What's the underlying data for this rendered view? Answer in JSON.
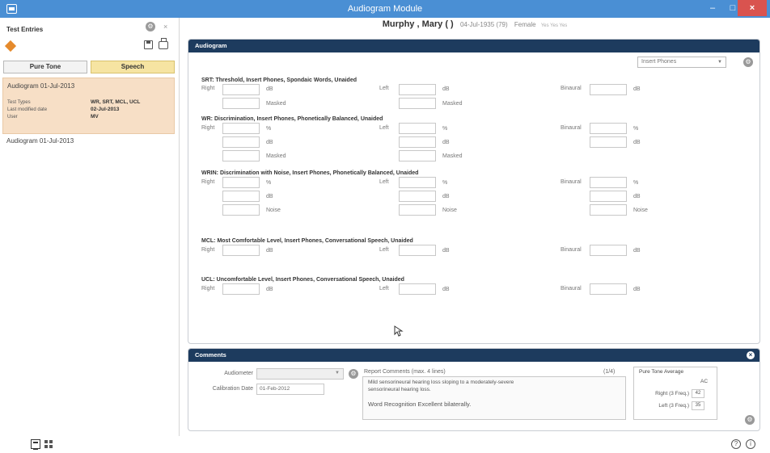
{
  "window": {
    "title": "Audiogram Module",
    "minimize": "–",
    "maximize": "□",
    "close": "×"
  },
  "sidebar": {
    "header": "Test Entries",
    "tabs": [
      {
        "label": "Pure Tone"
      },
      {
        "label": "Speech"
      }
    ],
    "entries": [
      {
        "title": "Audiogram   01-Jul-2013",
        "details": [
          {
            "key": "Test Types",
            "value": "WR, SRT, MCL, UCL"
          },
          {
            "key": "Last modified date",
            "value": "02-Jul-2013"
          },
          {
            "key": "User",
            "value": "MV"
          }
        ]
      },
      {
        "title": "Audiogram   01-Jul-2013"
      }
    ]
  },
  "patient": {
    "name": "Murphy , Mary ( )",
    "dob": "04-Jul-1935 (79)",
    "gender": "Female",
    "extra": "Yes Yes Yes"
  },
  "audiogram": {
    "header": "Audiogram",
    "transducer": "Insert Phones",
    "sections": {
      "srt": {
        "title": "SRT: Threshold, Insert Phones, Spondaic Words, Unaided",
        "right": "Right",
        "left": "Left",
        "binaural": "Binaural",
        "db": "dB",
        "masked": "Masked"
      },
      "wr": {
        "title": "WR: Discrimination, Insert Phones, Phonetically Balanced, Unaided",
        "right": "Right",
        "left": "Left",
        "binaural": "Binaural",
        "pct": "%",
        "db": "dB",
        "masked": "Masked"
      },
      "wrin": {
        "title": "WRIN: Discrimination with Noise, Insert Phones, Phonetically Balanced, Unaided",
        "right": "Right",
        "left": "Left",
        "binaural": "Binaural",
        "pct": "%",
        "db": "dB",
        "noise": "Noise"
      },
      "mcl": {
        "title": "MCL: Most Comfortable Level, Insert Phones, Conversational Speech, Unaided",
        "right": "Right",
        "left": "Left",
        "binaural": "Binaural",
        "db": "dB"
      },
      "ucl": {
        "title": "UCL: Uncomfortable Level, Insert Phones, Conversational Speech, Unaided",
        "right": "Right",
        "left": "Left",
        "binaural": "Binaural",
        "db": "dB"
      }
    }
  },
  "comments": {
    "header": "Comments",
    "audiometer_label": "Audiometer",
    "calibration_label": "Calibration Date",
    "calibration_value": "01-Feb-2012",
    "report_label": "Report Comments (max. 4 lines)",
    "report_count": "(1/4)",
    "report_lines": [
      "Mild sensorineural hearing loss sloping to a moderately-severe",
      "sensorineural hearing loss.",
      "",
      "Word Recognition Excellent bilaterally."
    ],
    "pta": {
      "title": "Pure Tone Average",
      "ac": "AC",
      "right_label": "Right (3 Freq.)",
      "right_value": "42",
      "left_label": "Left (3 Freq.)",
      "left_value": "35"
    }
  }
}
